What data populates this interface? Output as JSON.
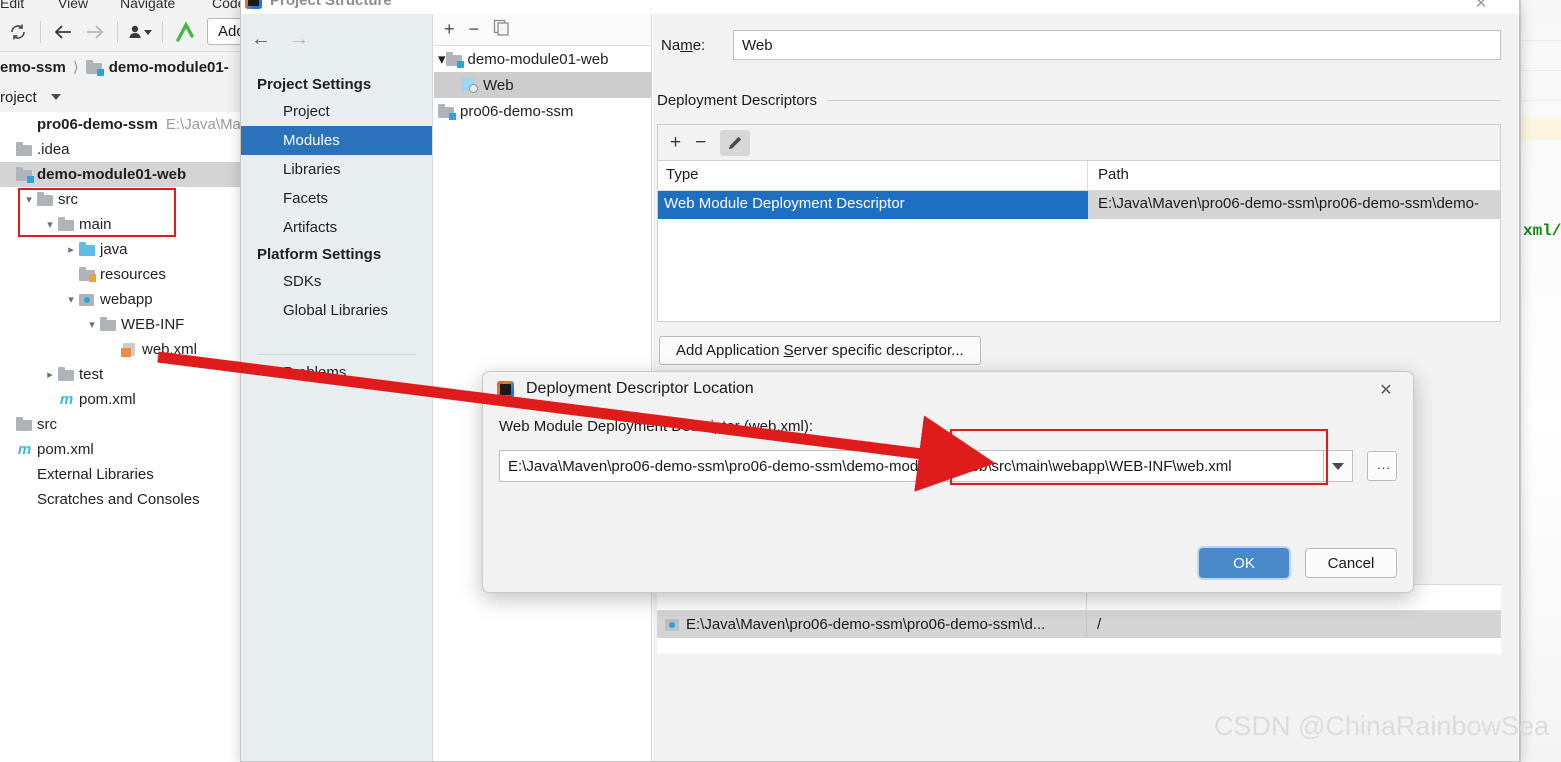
{
  "ide": {
    "menubar": [
      "Edit",
      "View",
      "Navigate",
      "Code"
    ],
    "toolbar": {
      "refresh_icon": "refresh-icon",
      "back_icon": "back-arrow-icon",
      "forward_icon": "forward-arrow-icon",
      "vcs_icon": "user-dropdown-icon",
      "update_icon": "vcs-update-icon",
      "add_button": "Add"
    },
    "breadcrumb": {
      "parent": "emo-ssm",
      "current": "demo-module01-"
    },
    "project_bar": {
      "label": "roject"
    },
    "tree": [
      {
        "label": "pro06-demo-ssm",
        "hint": "E:\\Java\\Maven",
        "arrow": "",
        "icon": "none",
        "bold": true,
        "indent": 0,
        "selected": false
      },
      {
        "label": ".idea",
        "hint": "",
        "arrow": "",
        "icon": "folder",
        "bold": false,
        "indent": 0,
        "selected": false
      },
      {
        "label": "demo-module01-web",
        "hint": "",
        "arrow": "",
        "icon": "module",
        "bold": true,
        "indent": 0,
        "selected": true
      },
      {
        "label": "src",
        "hint": "",
        "arrow": "v",
        "icon": "folder",
        "bold": false,
        "indent": 1,
        "selected": false
      },
      {
        "label": "main",
        "hint": "",
        "arrow": "v",
        "icon": "folder",
        "bold": false,
        "indent": 2,
        "selected": false
      },
      {
        "label": "java",
        "hint": "",
        "arrow": ">",
        "icon": "source-folder",
        "bold": false,
        "indent": 3,
        "selected": false
      },
      {
        "label": "resources",
        "hint": "",
        "arrow": "",
        "icon": "resource-folder",
        "bold": false,
        "indent": 3,
        "selected": false
      },
      {
        "label": "webapp",
        "hint": "",
        "arrow": "v",
        "icon": "webapp-folder",
        "bold": false,
        "indent": 3,
        "selected": false
      },
      {
        "label": "WEB-INF",
        "hint": "",
        "arrow": "v",
        "icon": "folder",
        "bold": false,
        "indent": 4,
        "selected": false
      },
      {
        "label": "web.xml",
        "hint": "",
        "arrow": "",
        "icon": "xml-file",
        "bold": false,
        "indent": 5,
        "selected": false
      },
      {
        "label": "test",
        "hint": "",
        "arrow": ">",
        "icon": "folder",
        "bold": false,
        "indent": 2,
        "selected": false
      },
      {
        "label": "pom.xml",
        "hint": "",
        "arrow": "",
        "icon": "maven-file",
        "bold": false,
        "indent": 2,
        "selected": false
      },
      {
        "label": "src",
        "hint": "",
        "arrow": "",
        "icon": "folder",
        "bold": false,
        "indent": 0,
        "selected": false
      },
      {
        "label": "pom.xml",
        "hint": "",
        "arrow": "",
        "icon": "maven-file",
        "bold": false,
        "indent": 0,
        "selected": false
      },
      {
        "label": "External Libraries",
        "hint": "",
        "arrow": "",
        "icon": "none",
        "bold": false,
        "indent": 0,
        "selected": false
      },
      {
        "label": "Scratches and Consoles",
        "hint": "",
        "arrow": "",
        "icon": "none",
        "bold": false,
        "indent": 0,
        "selected": false
      }
    ],
    "editor_code": "xml/"
  },
  "project_structure": {
    "title": "Project Structure",
    "close_icon": "close-icon",
    "nav": {
      "back_icon": "back-arrow-icon",
      "forward_icon": "forward-arrow-icon"
    },
    "groups": [
      {
        "title": "Project Settings",
        "items": [
          {
            "label": "Project",
            "active": false
          },
          {
            "label": "Modules",
            "active": true
          },
          {
            "label": "Libraries",
            "active": false
          },
          {
            "label": "Facets",
            "active": false
          },
          {
            "label": "Artifacts",
            "active": false
          }
        ]
      },
      {
        "title": "Platform Settings",
        "items": [
          {
            "label": "SDKs",
            "active": false
          },
          {
            "label": "Global Libraries",
            "active": false
          }
        ]
      }
    ],
    "problems_label": "Problems",
    "modules_toolbar": {
      "add_icon": "plus-icon",
      "remove_icon": "minus-icon",
      "copy_icon": "copy-icon"
    },
    "modules_tree": [
      {
        "label": "demo-module01-web",
        "arrow": "v",
        "icon": "module",
        "indent": 0,
        "selected": false
      },
      {
        "label": "Web",
        "arrow": "",
        "icon": "web-facet",
        "indent": 1,
        "selected": true
      },
      {
        "label": "pro06-demo-ssm",
        "arrow": "",
        "icon": "module",
        "indent": 0,
        "selected": false
      }
    ],
    "right": {
      "name_label": "Name:",
      "name_value": "Web",
      "section_title": "Deployment Descriptors",
      "table_toolbar": {
        "add_icon": "plus-icon",
        "remove_icon": "minus-icon",
        "edit_icon": "pencil-icon"
      },
      "columns": [
        "Type",
        "Path"
      ],
      "rows": [
        {
          "type": "Web Module Deployment Descriptor",
          "path": "E:\\Java\\Maven\\pro06-demo-ssm\\pro06-demo-ssm\\demo-"
        }
      ],
      "add_server_button": "Add Application Server specific descriptor...",
      "resource_rows": [
        {
          "path": "E:\\Java\\Maven\\pro06-demo-ssm\\pro06-demo-ssm\\d...",
          "mapping": "/"
        }
      ]
    }
  },
  "modal": {
    "title": "Deployment Descriptor Location",
    "app_icon": "intellij-idea-icon",
    "close_icon": "close-icon",
    "field_label": "Web Module Deployment Descriptor (web.xml):",
    "field_value": "E:\\Java\\Maven\\pro06-demo-ssm\\pro06-demo-ssm\\demo-module01-web\\src\\main\\webapp\\WEB-INF\\web.xml",
    "dropdown_icon": "chevron-down-icon",
    "browse_button": "...",
    "ok_button": "OK",
    "cancel_button": "Cancel"
  },
  "watermark": "CSDN @ChinaRainbowSea"
}
